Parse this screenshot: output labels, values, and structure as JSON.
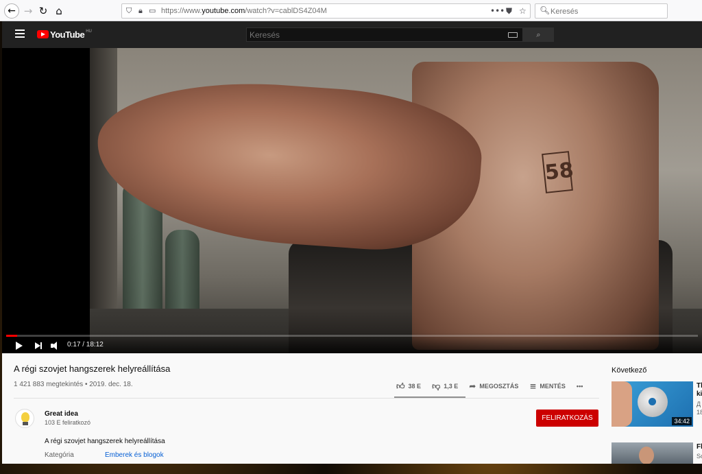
{
  "browser": {
    "url_prefix": "https://www.",
    "url_domain": "youtube.com",
    "url_rest": "/watch?v=cablDS4Z04M",
    "search_placeholder": "Keresés",
    "more_label": "•••"
  },
  "header": {
    "brand": "YouTube",
    "region": "HU",
    "search_placeholder": "Keresés"
  },
  "player": {
    "time": "0:17 / 18:12",
    "progress_fraction": 0.0156,
    "stamp_text": "58"
  },
  "video": {
    "title": "A régi szovjet hangszerek helyreállítása",
    "meta": "1 421 883 megtekintés • 2019. dec. 18.",
    "likes": "38 E",
    "dislikes": "1,3 E",
    "share_label": "MEGOSZTÁS",
    "save_label": "MENTÉS",
    "more_label": "•••"
  },
  "channel": {
    "name": "Great idea",
    "subscribers": "103 E feliratkozó",
    "subscribe_label": "FELIRATKOZÁS",
    "description": "A régi szovjet hangszerek helyreállítása",
    "category_label": "Kategória",
    "category_value": "Emberek és blogok"
  },
  "sidebar": {
    "next_label": "Következő",
    "items": [
      {
        "title_line1": "Th",
        "title_line2": "ki",
        "line3": "Д",
        "line4": "18",
        "duration": "34:42"
      },
      {
        "title_line1": "Fl",
        "line2": "Sc"
      }
    ]
  },
  "icons": {
    "back": "back-arrow-icon",
    "forward": "forward-arrow-icon",
    "reload": "reload-icon",
    "home": "home-icon",
    "shield": "shield-icon",
    "lock": "lock-icon",
    "pocket": "pocket-icon",
    "bookmark": "star-icon",
    "search": "search-icon",
    "keyboard": "keyboard-icon",
    "thumbs_up": "thumbs-up-icon",
    "thumbs_down": "thumbs-down-icon",
    "share": "share-arrow-icon",
    "save": "playlist-add-icon"
  },
  "colors": {
    "accent": "#ff0000",
    "subscribe": "#cc0000",
    "link": "#065fd4"
  }
}
